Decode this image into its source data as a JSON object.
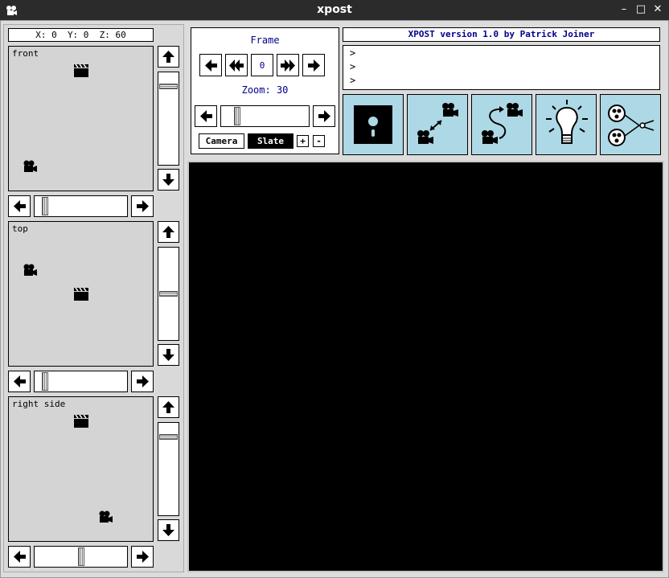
{
  "window": {
    "title": "xpost"
  },
  "coords": {
    "text": "X: 0  Y: 0  Z: 60"
  },
  "views": [
    {
      "label": "front"
    },
    {
      "label": "top"
    },
    {
      "label": "right side"
    }
  ],
  "frame": {
    "label": "Frame",
    "value": "0",
    "zoom_label": "Zoom: 30"
  },
  "buttons": {
    "camera": "Camera",
    "slate": "Slate",
    "plus": "+",
    "minus": "-"
  },
  "header": {
    "version": "XPOST version 1.0 by Patrick Joiner"
  },
  "console": {
    "lines": [
      ">",
      ">",
      ">"
    ]
  },
  "colors": {
    "tool_bg": "#add8e6",
    "canvas": "#000000",
    "text_accent": "#00008b"
  }
}
